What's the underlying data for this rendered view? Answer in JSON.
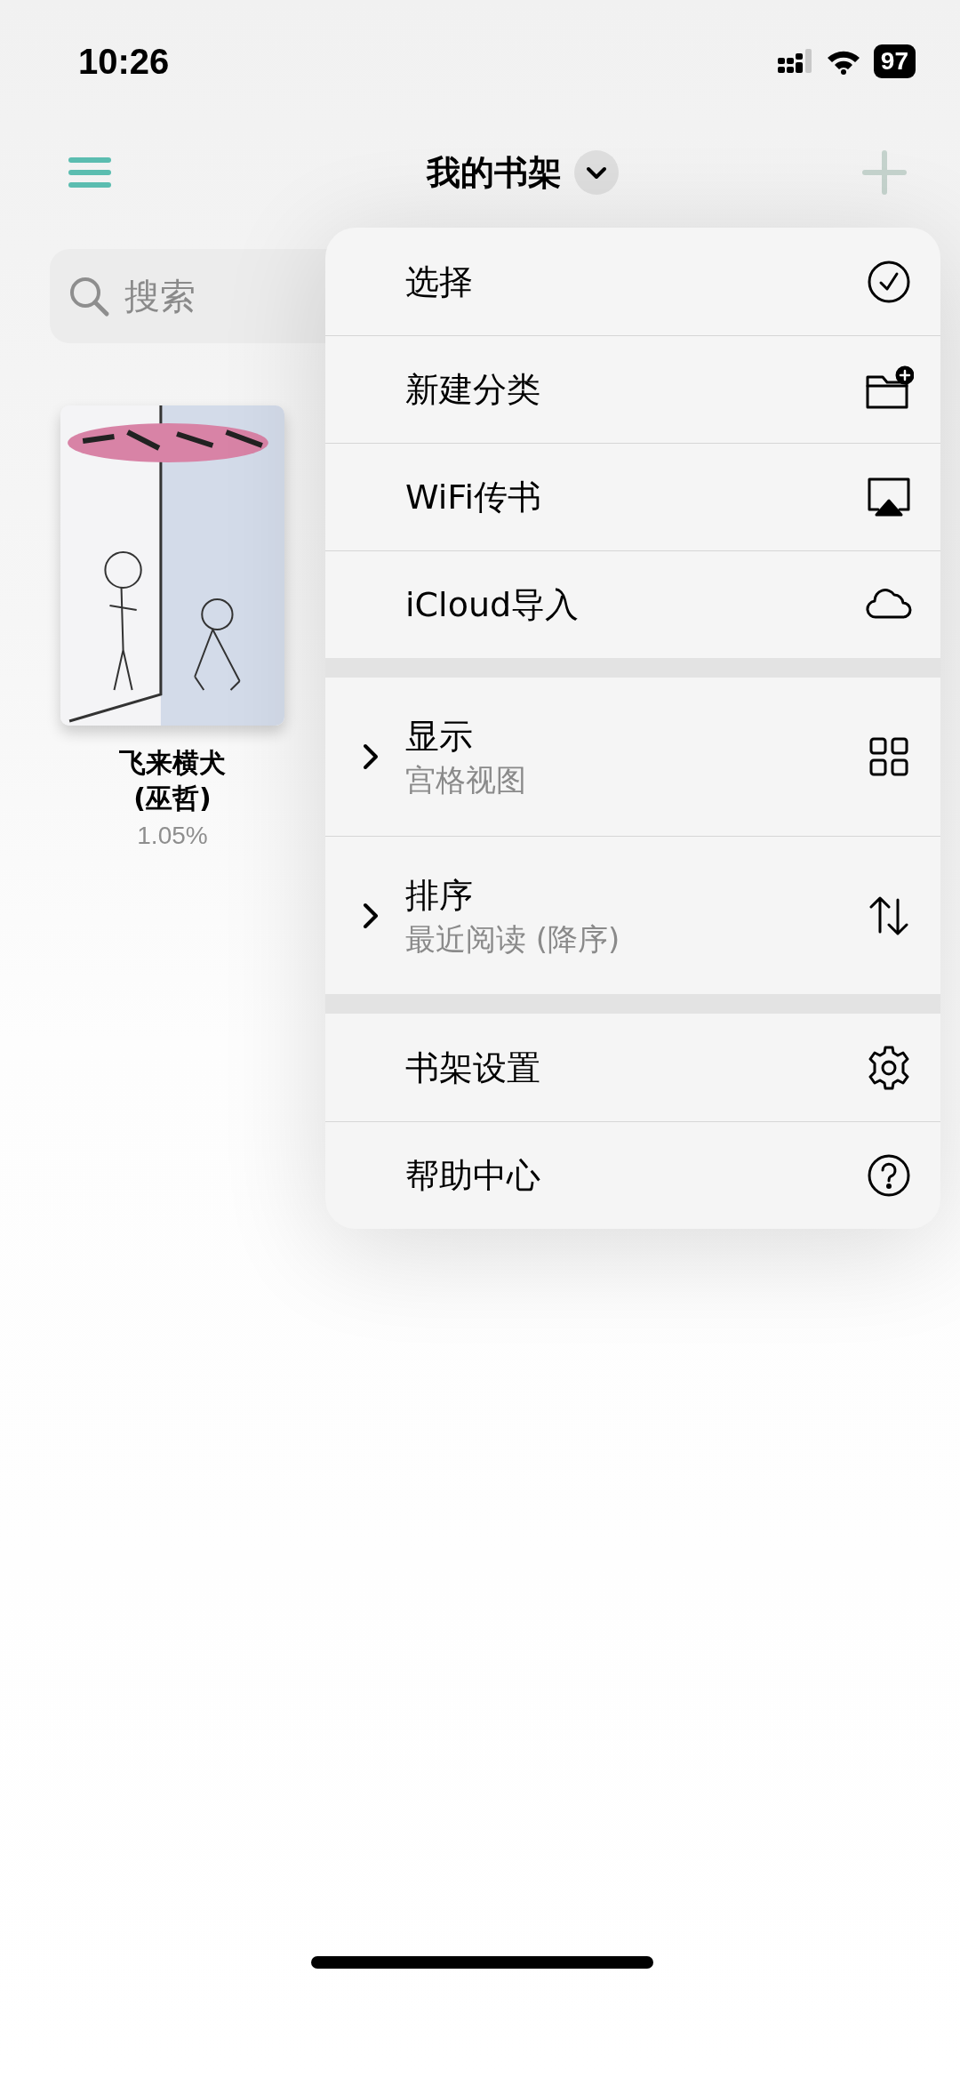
{
  "status_bar": {
    "time": "10:26",
    "battery": "97"
  },
  "header": {
    "title": "我的书架"
  },
  "search": {
    "placeholder": "搜索"
  },
  "books": [
    {
      "kind": "picture",
      "title": "飞来横犬\n(巫哲)",
      "progress": "1.05%"
    }
  ],
  "menu": {
    "groups": [
      [
        {
          "kind": "action",
          "label": "选择"
        },
        {
          "kind": "action",
          "label": "新建分类"
        },
        {
          "kind": "action",
          "label": "WiFi传书"
        },
        {
          "kind": "action",
          "label": "iCloud导入"
        }
      ],
      [
        {
          "kind": "submenu",
          "label": "显示",
          "value": "宫格视图"
        },
        {
          "kind": "submenu",
          "label": "排序",
          "value": "最近阅读 (降序)"
        }
      ],
      [
        {
          "kind": "action",
          "label": "书架设置"
        },
        {
          "kind": "action",
          "label": "帮助中心"
        }
      ]
    ]
  }
}
